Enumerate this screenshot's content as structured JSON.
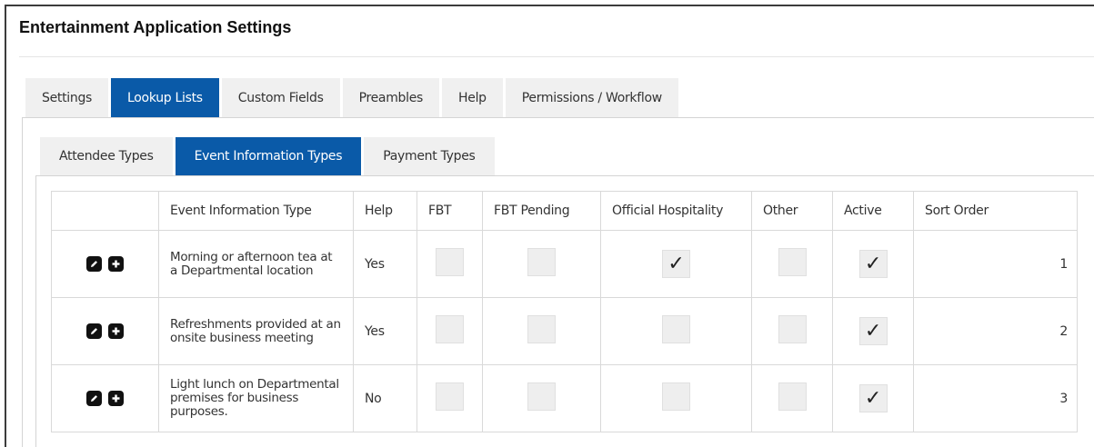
{
  "app": {
    "title": "Entertainment Application Settings"
  },
  "main_tabs": [
    {
      "label": "Settings",
      "active": false
    },
    {
      "label": "Lookup Lists",
      "active": true
    },
    {
      "label": "Custom Fields",
      "active": false
    },
    {
      "label": "Preambles",
      "active": false
    },
    {
      "label": "Help",
      "active": false
    },
    {
      "label": "Permissions / Workflow",
      "active": false
    }
  ],
  "sub_tabs": [
    {
      "label": "Attendee Types",
      "active": false
    },
    {
      "label": "Event Information Types",
      "active": true
    },
    {
      "label": "Payment Types",
      "active": false
    }
  ],
  "table": {
    "columns": [
      "",
      "Event Information Type",
      "Help",
      "FBT",
      "FBT Pending",
      "Official Hospitality",
      "Other",
      "Active",
      "Sort Order"
    ],
    "rows": [
      {
        "type": "Morning or afternoon tea at a Departmental location",
        "help": "Yes",
        "fbt": false,
        "fbt_pending": false,
        "official_hospitality": true,
        "other": false,
        "active": true,
        "sort_order": "1"
      },
      {
        "type": "Refreshments provided at an onsite business meeting",
        "help": "Yes",
        "fbt": false,
        "fbt_pending": false,
        "official_hospitality": false,
        "other": false,
        "active": true,
        "sort_order": "2"
      },
      {
        "type": "Light lunch on Departmental premises for business purposes.",
        "help": "No",
        "fbt": false,
        "fbt_pending": false,
        "official_hospitality": false,
        "other": false,
        "active": true,
        "sort_order": "3"
      }
    ]
  },
  "icons": {
    "edit": "pencil-icon",
    "add": "plus-icon",
    "check": "checkmark-icon"
  },
  "colors": {
    "accent": "#0a5aa8",
    "tab_bg": "#f0f0f0",
    "checkbox_bg": "#eeeeee"
  }
}
